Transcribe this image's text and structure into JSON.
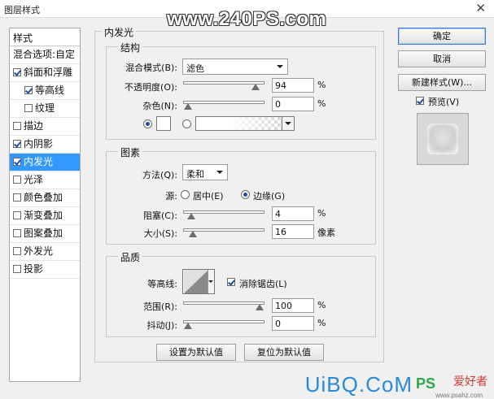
{
  "window": {
    "title": "图层样式",
    "close_glyph": "✕"
  },
  "watermark": "www.240PS.com",
  "left_panel": {
    "header": "样式",
    "blend_options": "混合选项:自定",
    "items": [
      {
        "label": "斜面和浮雕",
        "checked": true,
        "indent": false,
        "selected": false
      },
      {
        "label": "等高线",
        "checked": true,
        "indent": true,
        "selected": false
      },
      {
        "label": "纹理",
        "checked": false,
        "indent": true,
        "selected": false
      },
      {
        "label": "描边",
        "checked": false,
        "indent": false,
        "selected": false
      },
      {
        "label": "内阴影",
        "checked": true,
        "indent": false,
        "selected": false
      },
      {
        "label": "内发光",
        "checked": true,
        "indent": false,
        "selected": true
      },
      {
        "label": "光泽",
        "checked": false,
        "indent": false,
        "selected": false
      },
      {
        "label": "颜色叠加",
        "checked": false,
        "indent": false,
        "selected": false
      },
      {
        "label": "渐变叠加",
        "checked": false,
        "indent": false,
        "selected": false
      },
      {
        "label": "图案叠加",
        "checked": false,
        "indent": false,
        "selected": false
      },
      {
        "label": "外发光",
        "checked": false,
        "indent": false,
        "selected": false
      },
      {
        "label": "投影",
        "checked": false,
        "indent": false,
        "selected": false
      }
    ]
  },
  "inner_glow": {
    "title": "内发光",
    "structure": {
      "title": "结构",
      "blend_mode_label": "混合模式(B):",
      "blend_mode_value": "滤色",
      "opacity_label": "不透明度(O):",
      "opacity_value": "94",
      "opacity_fraction": 0.94,
      "noise_label": "杂色(N):",
      "noise_value": "0",
      "noise_fraction": 0.0,
      "percent": "%"
    },
    "elements": {
      "title": "图素",
      "technique_label": "方法(Q):",
      "technique_value": "柔和",
      "source_label": "源:",
      "source_center": "居中(E)",
      "source_edge": "边缘(G)",
      "choke_label": "阻塞(C):",
      "choke_value": "4",
      "choke_fraction": 0.04,
      "size_label": "大小(S):",
      "size_value": "16",
      "size_fraction": 0.065,
      "percent": "%",
      "px_unit": "像素"
    },
    "quality": {
      "title": "品质",
      "contour_label": "等高线:",
      "anti_alias_label": "消除锯齿(L)",
      "range_label": "范围(R):",
      "range_value": "100",
      "range_fraction": 1.0,
      "jitter_label": "抖动(J):",
      "jitter_value": "0",
      "jitter_fraction": 0.0,
      "percent": "%"
    },
    "make_default": "设置为默认值",
    "reset_default": "复位为默认值"
  },
  "right_buttons": {
    "ok": "确定",
    "cancel": "取消",
    "new_style": "新建样式(W)...",
    "preview_label": "预览(V)"
  },
  "footer_logo": {
    "uibq": "UiBQ.CoM",
    "ps": "PS",
    "site": "爱好者",
    "small": "www.psahz.com"
  }
}
